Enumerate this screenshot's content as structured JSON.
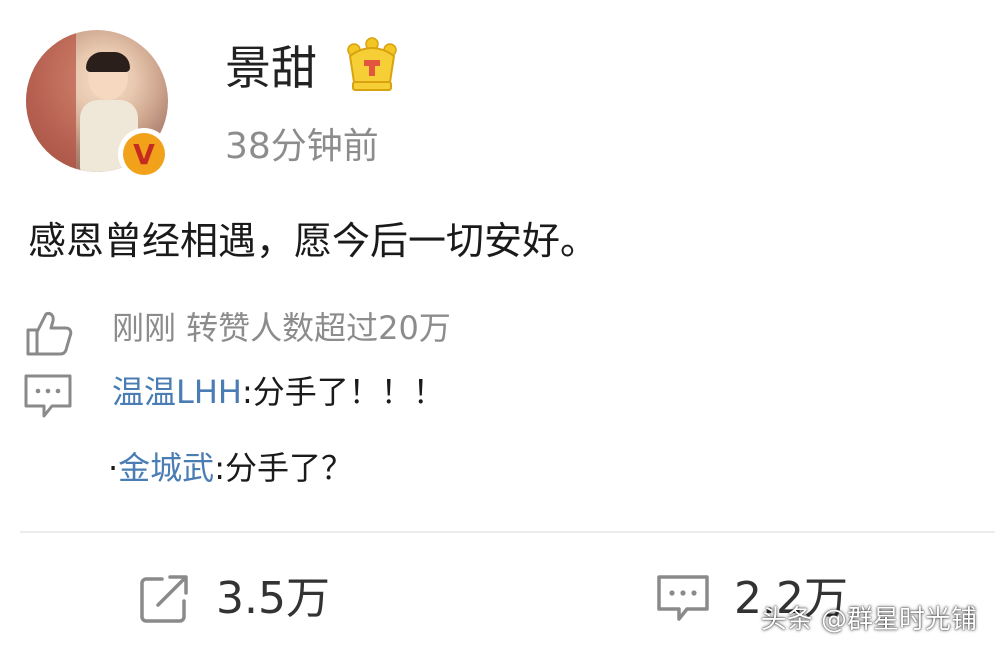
{
  "header": {
    "username": "景甜",
    "time": "38分钟前"
  },
  "post": {
    "text": "感恩曾经相遇，愿今后一切安好。"
  },
  "likes": {
    "text": "刚刚 转赞人数超过20万"
  },
  "comments": [
    {
      "prefix": "",
      "author": "温温LHH",
      "text": ":分手了！！！"
    },
    {
      "prefix": "·",
      "author": "金城武",
      "text": ":分手了？"
    }
  ],
  "actions": {
    "repost_count": "3.5万",
    "comment_count": "2.2万"
  },
  "watermark": "头条 @群星时光铺",
  "icons": {
    "avatar": "avatar",
    "verified": "verified-v-badge-icon",
    "crown": "crown-icon",
    "like": "thumbs-up-icon",
    "comment": "comment-bubble-icon",
    "repost": "repost-icon"
  },
  "colors": {
    "author": "#4a7db3",
    "muted": "#8c8c8c",
    "badge": "#f2a11b",
    "crown": "#f3c623"
  }
}
